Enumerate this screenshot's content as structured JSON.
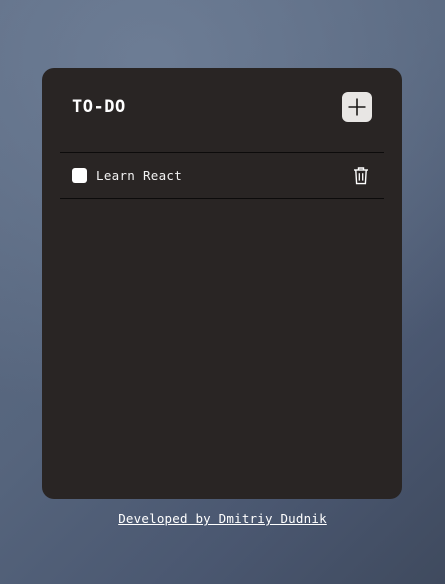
{
  "card": {
    "title": "TO-DO",
    "add_button_icon": "plus-icon"
  },
  "todos": [
    {
      "label": "Learn React",
      "checked": false,
      "delete_icon": "trash-icon"
    }
  ],
  "footer": {
    "credit": "Developed by Dmitriy Dudnik"
  },
  "colors": {
    "card_background": "#292524",
    "add_button_background": "#e8e6e4",
    "divider": "#0c0b0b",
    "text": "#ffffff"
  }
}
